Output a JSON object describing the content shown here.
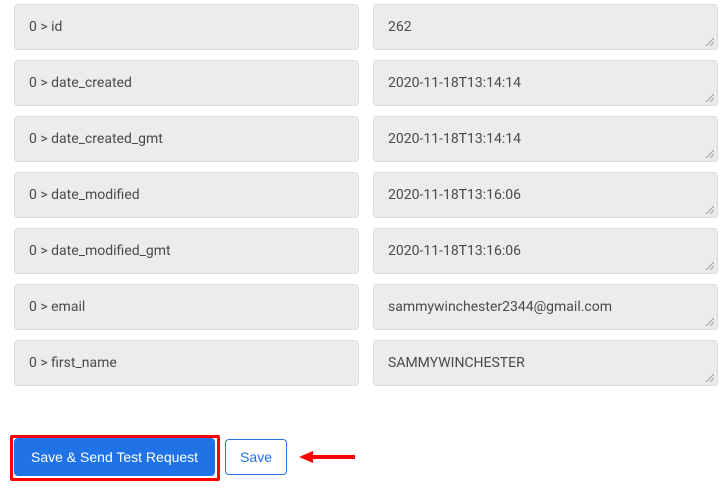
{
  "rows": [
    {
      "key": "0 > id",
      "value": "262"
    },
    {
      "key": "0 > date_created",
      "value": "2020-11-18T13:14:14"
    },
    {
      "key": "0 > date_created_gmt",
      "value": "2020-11-18T13:14:14"
    },
    {
      "key": "0 > date_modified",
      "value": "2020-11-18T13:16:06"
    },
    {
      "key": "0 > date_modified_gmt",
      "value": "2020-11-18T13:16:06"
    },
    {
      "key": "0 > email",
      "value": "sammywinchester2344@gmail.com"
    },
    {
      "key": "0 > first_name",
      "value": "SAMMYWINCHESTER"
    }
  ],
  "buttons": {
    "primary": "Save & Send Test Request",
    "secondary": "Save"
  }
}
